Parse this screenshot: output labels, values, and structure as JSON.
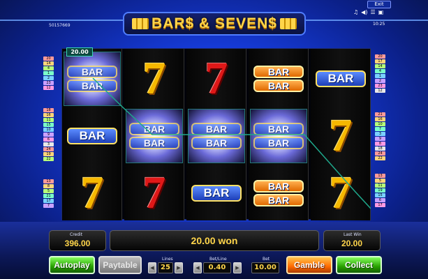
{
  "header": {
    "logo_text": "BAR$ & SEVEN$",
    "serial": "50157669",
    "exit_label": "Exit",
    "clock": "10:25",
    "sys_icons": [
      "music-icon",
      "speaker-icon",
      "menu-icon",
      "fullscreen-icon"
    ]
  },
  "reels": [
    [
      "bar-double",
      "bar",
      "seven-gold"
    ],
    [
      "seven-gold",
      "bar-double",
      "seven-red"
    ],
    [
      "seven-red",
      "bar-double",
      "bar"
    ],
    [
      "bar-double-orange",
      "bar-double",
      "bar-double-orange"
    ],
    [
      "bar",
      "seven-gold",
      "seven-gold"
    ]
  ],
  "symbols": {
    "bar_label": "BAR",
    "seven_label": "7"
  },
  "win_badge": "20.00",
  "line_numbers": {
    "left_top": [
      "20",
      "14",
      "4",
      "1",
      "2",
      "23",
      "12"
    ],
    "left_mid": [
      "18",
      "16",
      "11",
      "15",
      "10",
      "9",
      "6",
      "3",
      "24",
      "19",
      "22"
    ],
    "left_bot": [
      "13",
      "8",
      "5",
      "21",
      "17",
      "7"
    ],
    "right_top": [
      "20",
      "17",
      "14",
      "4",
      "1",
      "2",
      "23",
      "12"
    ],
    "right_mid": [
      "21",
      "16",
      "10",
      "7",
      "3",
      "9",
      "8",
      "18",
      "24",
      "22"
    ],
    "right_bot": [
      "13",
      "5",
      "11",
      "19",
      "15",
      "6",
      "17"
    ]
  },
  "panel": {
    "credit_label": "Credit",
    "credit_value": "396.00",
    "message": "20.00 won",
    "last_win_label": "Last Win",
    "last_win_value": "20.00",
    "autoplay_label": "Autoplay",
    "paytable_label": "Paytable",
    "lines_label": "Lines",
    "lines_value": "25",
    "bet_line_label": "Bet/Line",
    "bet_line_value": "0.40",
    "bet_label": "Bet",
    "bet_value": "10.00",
    "gamble_label": "Gamble",
    "collect_label": "Collect"
  },
  "colors": {
    "background": "#163bd9",
    "accent_gold": "#ffd54a",
    "green_button": "#28a000",
    "orange_button": "#ff6a00",
    "winline": "#1fa88b"
  }
}
